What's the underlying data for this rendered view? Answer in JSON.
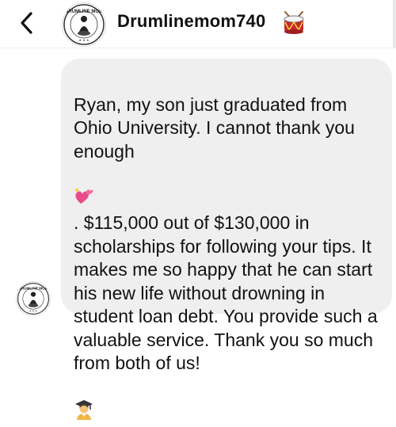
{
  "header": {
    "username": "Drumlinemom740",
    "avatar_logo_text": "DRUMLINE MOM",
    "status_icon": "drum-icon"
  },
  "message": {
    "line_1": "Ryan, my son just graduated from Ohio University. I cannot thank you enough",
    "emoji_1": "sparkling-hearts-icon",
    "line_2": ". $115,000 out of $130,000 in scholarships for following your tips. It makes me so happy that he can start his new life without drowning in student loan debt. You provide such a valuable service. Thank you so much from both of us!",
    "emoji_2": "graduate-icon",
    "bubble_color": "#efefef"
  }
}
